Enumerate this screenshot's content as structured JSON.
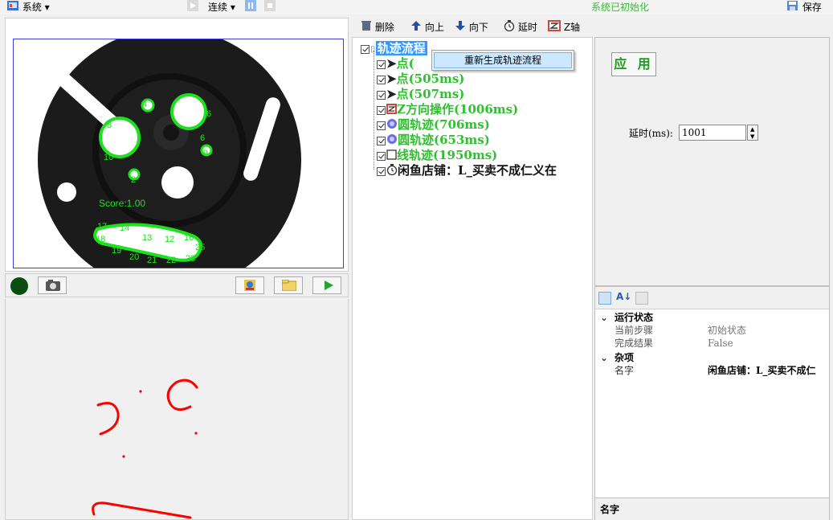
{
  "toolbar": {
    "system_label": "系统 ▾",
    "continuous_label": "连续 ▾",
    "status_text": "系统已初始化",
    "save_label": "保存",
    "status_color": "#2fbf2f"
  },
  "vision": {
    "score_label": "Score:1.00",
    "hole_labels": [
      "4",
      "6",
      "8",
      "9",
      "10",
      "2",
      "6"
    ],
    "curve_labels": [
      "17",
      "14",
      "13",
      "12",
      "16",
      "19",
      "20",
      "21",
      "22",
      "23",
      "25",
      "18"
    ]
  },
  "flow_toolbar": {
    "delete_label": "删除",
    "up_label": "向上",
    "down_label": "向下",
    "delay_label": "延时",
    "z_label": "Z轴"
  },
  "tree": {
    "root_label": "轨迹流程",
    "items": [
      {
        "label": "点(",
        "icon": "cursor-icon"
      },
      {
        "label": "点(505ms)",
        "icon": "cursor-icon"
      },
      {
        "label": "点(507ms)",
        "icon": "cursor-icon"
      },
      {
        "label": "Z方向操作(1006ms)",
        "icon": "z-axis-icon"
      },
      {
        "label": "圆轨迹(706ms)",
        "icon": "circle-track-icon"
      },
      {
        "label": "圆轨迹(653ms)",
        "icon": "circle-track-icon"
      },
      {
        "label": "线轨迹(1950ms)",
        "icon": "line-track-icon"
      },
      {
        "label": "闲鱼店铺：L_买卖不成仁义在",
        "icon": "timer-icon"
      }
    ]
  },
  "context_menu": {
    "item_label": "重新生成轨迹流程"
  },
  "settings": {
    "apply_label": "应 用",
    "delay_label": "延时(ms):",
    "delay_value": "1001"
  },
  "property_grid": {
    "categories": [
      {
        "name": "运行状态",
        "rows": [
          {
            "name": "当前步骤",
            "value": "初始状态"
          },
          {
            "name": "完成结果",
            "value": "False"
          }
        ]
      },
      {
        "name": "杂项",
        "rows": [
          {
            "name": "名字",
            "value": "闲鱼店铺：L_买卖不成仁"
          }
        ]
      }
    ],
    "description_title": "名字"
  }
}
